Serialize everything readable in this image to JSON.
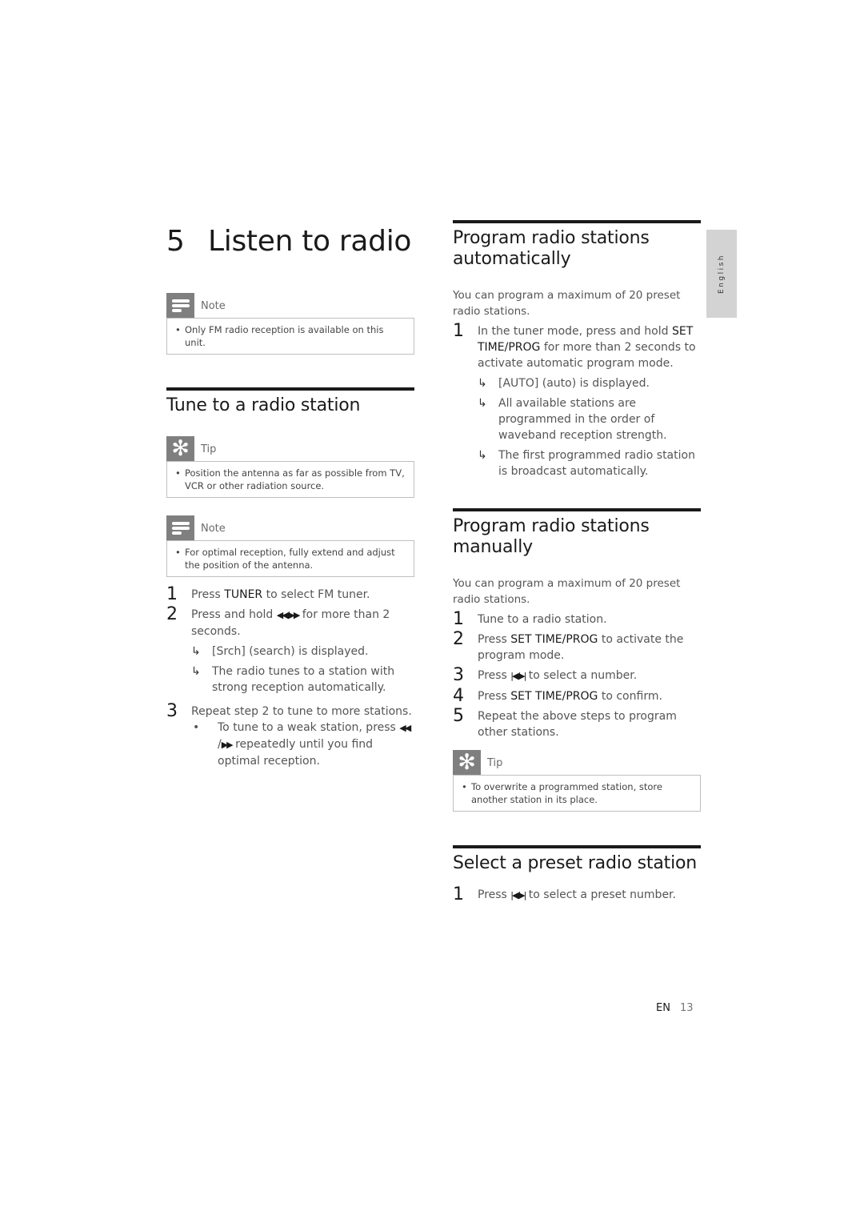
{
  "side_tab": {
    "label": "English"
  },
  "chapter": {
    "number": "5",
    "title": "Listen to radio"
  },
  "left": {
    "note1": {
      "label": "Note",
      "icon": "note-icon",
      "text": "Only FM radio reception is available on this unit."
    },
    "tune": {
      "title": "Tune to a radio station",
      "tip": {
        "label": "Tip",
        "icon": "tip-icon",
        "text": "Position the antenna as far as possible from TV, VCR or other radiation source."
      },
      "note": {
        "label": "Note",
        "icon": "note-icon",
        "text": "For optimal reception, fully extend and adjust the position of the antenna."
      },
      "steps": [
        {
          "n": "1",
          "pre": "Press ",
          "key": "TUNER",
          "post": " to select FM tuner."
        },
        {
          "n": "2",
          "pre": "Press and hold ",
          "sym": "◀◀/▶▶",
          "post": " for more than 2 seconds.",
          "results": [
            "[Srch] (search) is displayed.",
            "The radio tunes to a station with strong reception automatically."
          ]
        },
        {
          "n": "3",
          "text": "Repeat step 2 to tune to more stations.",
          "bullet": {
            "pre": "To tune to a weak station, press ",
            "sym1": "◀◀",
            "mid": " /",
            "sym2": "▶▶",
            "post": " repeatedly until you find optimal reception."
          }
        }
      ]
    }
  },
  "right": {
    "auto": {
      "title": "Program radio stations automatically",
      "intro": "You can program a maximum of 20 preset radio stations.",
      "step1": {
        "n": "1",
        "pre": "In the tuner mode, press and hold ",
        "key": "SET TIME/PROG",
        "post": " for more than 2 seconds to activate automatic program mode."
      },
      "results": [
        "[AUTO] (auto) is displayed.",
        "All available stations are programmed in the order of waveband reception strength.",
        "The first programmed radio station is broadcast automatically."
      ]
    },
    "manual": {
      "title": "Program radio stations manually",
      "intro": "You can program a maximum of 20 preset radio stations.",
      "steps": [
        {
          "n": "1",
          "text": "Tune to a radio station."
        },
        {
          "n": "2",
          "pre": "Press ",
          "key": "SET TIME/PROG",
          "post": " to activate the program mode."
        },
        {
          "n": "3",
          "pre": "Press ",
          "sym": "|◀/▶|",
          "post": " to select a number."
        },
        {
          "n": "4",
          "pre": "Press ",
          "key": "SET TIME/PROG",
          "post": " to confirm."
        },
        {
          "n": "5",
          "text": "Repeat the above steps to program other stations."
        }
      ],
      "tip": {
        "label": "Tip",
        "icon": "tip-icon",
        "text": "To overwrite a programmed station, store another station in its place."
      }
    },
    "preset": {
      "title": "Select a preset radio station",
      "step1": {
        "n": "1",
        "pre": "Press ",
        "sym": "|◀/▶|",
        "post": " to select a preset number."
      }
    }
  },
  "footer": {
    "lang": "EN",
    "page": "13"
  }
}
